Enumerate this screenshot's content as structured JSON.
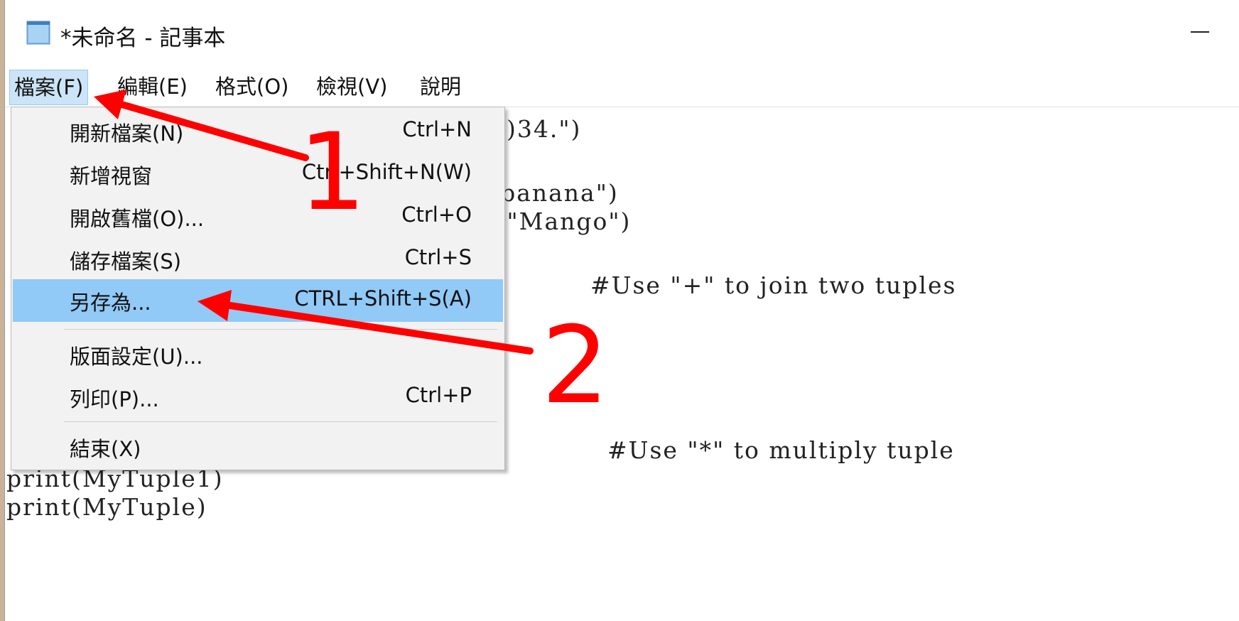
{
  "window": {
    "title": "*未命名 - 記事本",
    "app_icon": "notepad-icon",
    "minimize_icon": "minimize-icon"
  },
  "menubar": {
    "items": [
      {
        "label": "檔案(F)"
      },
      {
        "label": "編輯(E)"
      },
      {
        "label": "格式(O)"
      },
      {
        "label": "檢視(V)"
      },
      {
        "label": "說明"
      }
    ]
  },
  "file_menu": {
    "items": [
      {
        "label": "開新檔案(N)",
        "shortcut": "Ctrl+N"
      },
      {
        "label": "新增視窗",
        "shortcut": "Ctrl+Shift+N(W)"
      },
      {
        "label": "開啟舊檔(O)...",
        "shortcut": "Ctrl+O"
      },
      {
        "label": "儲存檔案(S)",
        "shortcut": "Ctrl+S"
      },
      {
        "label": "另存為...",
        "shortcut": "CTRL+Shift+S(A)"
      },
      {
        "label": "版面設定(U)...",
        "shortcut": ""
      },
      {
        "label": "列印(P)...",
        "shortcut": "Ctrl+P"
      },
      {
        "label": "結束(X)",
        "shortcut": ""
      }
    ]
  },
  "editor": {
    "lines": [
      ")34.\")",
      "'banana\")",
      " \"Mango\")",
      "#Use \"+\" to join two tuples",
      "#Use \"*\" to multiply tuple",
      "print(MyTuple1)",
      "print(MyTuple)"
    ]
  },
  "annotations": {
    "step1": "1",
    "step2": "2",
    "arrow_color": "#ff0000"
  }
}
